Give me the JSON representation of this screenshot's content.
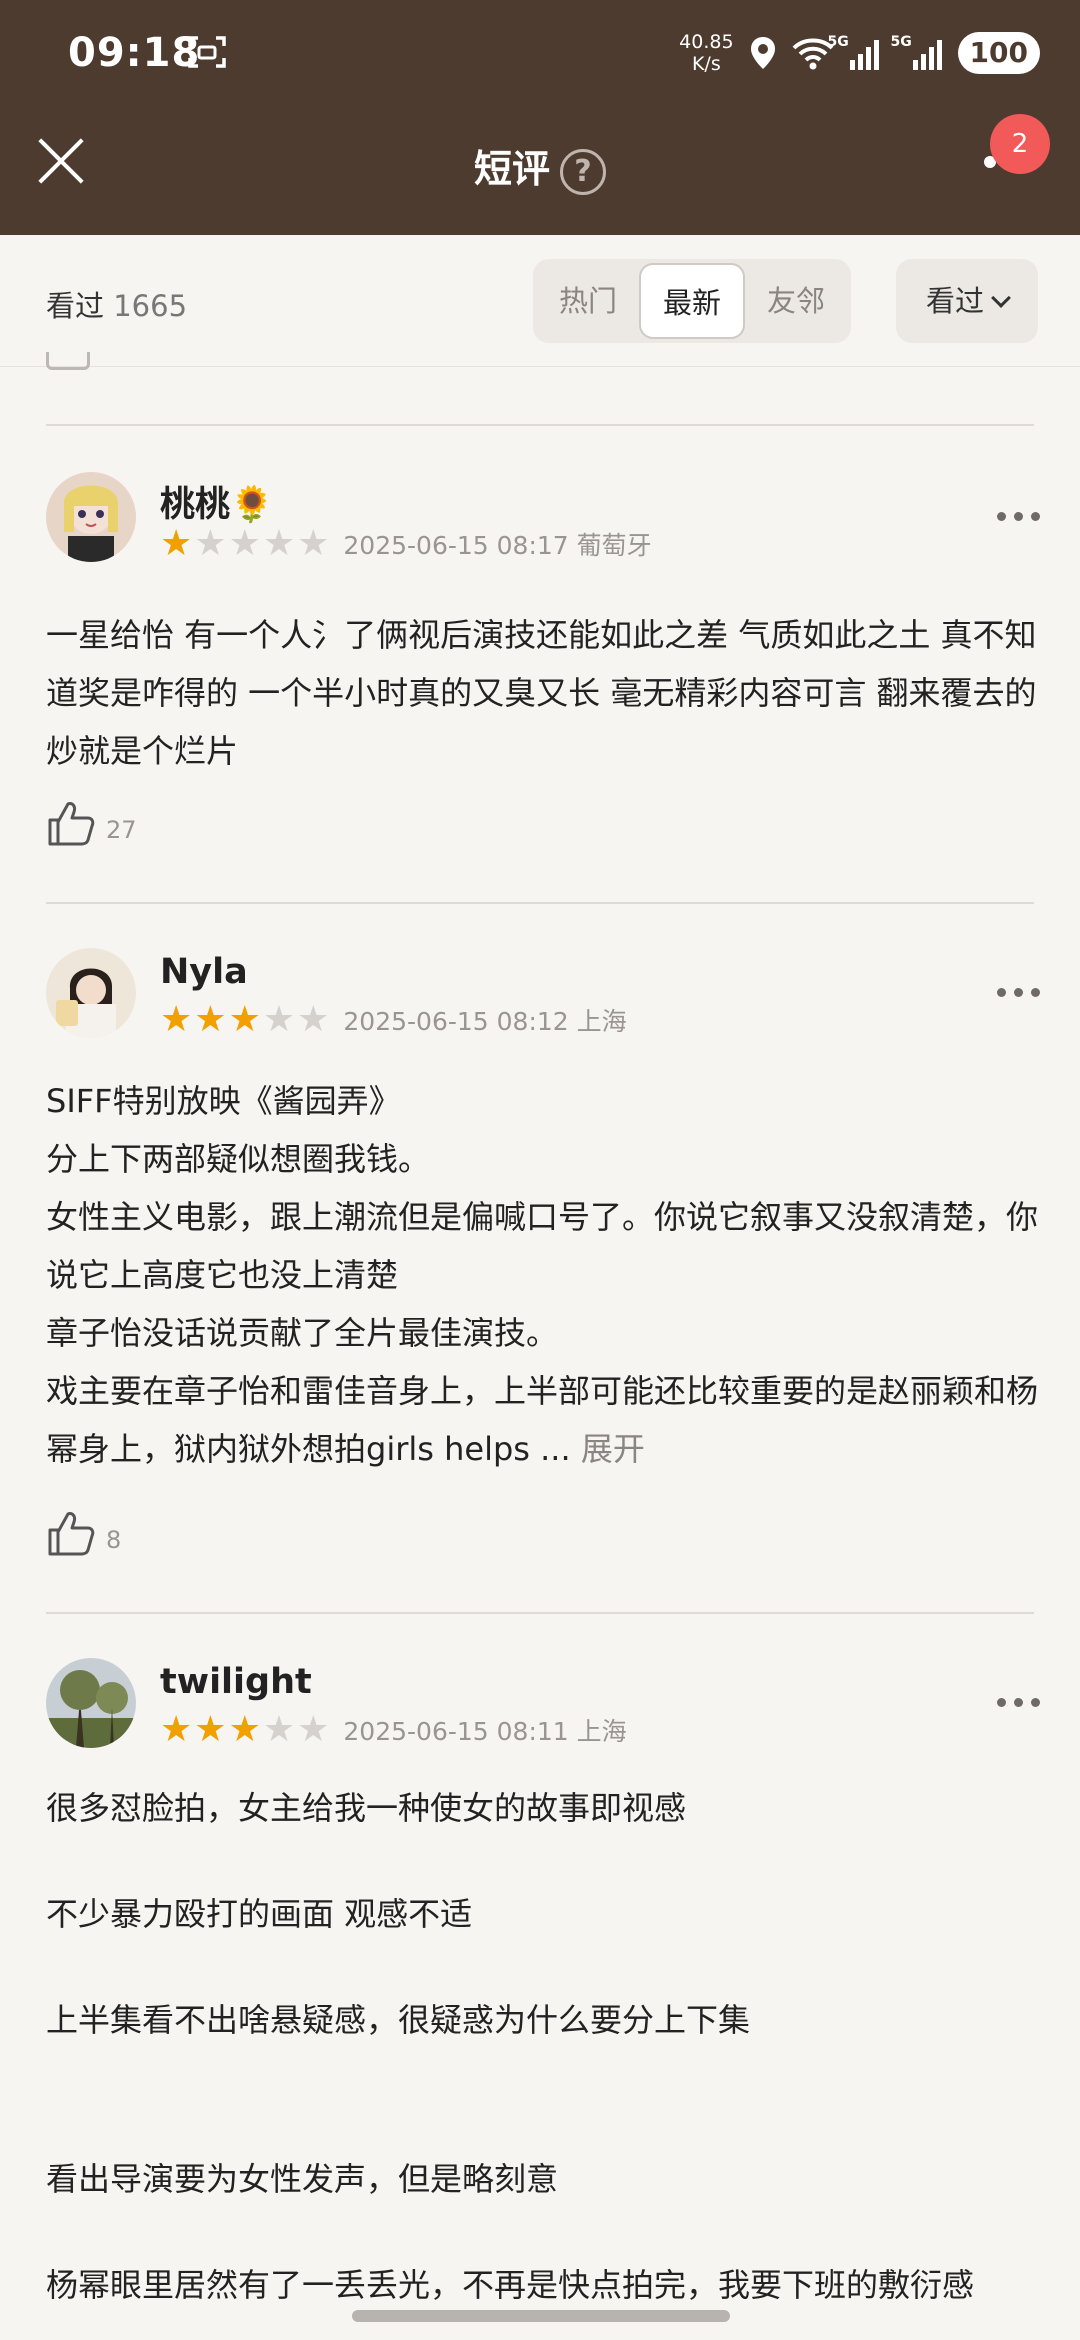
{
  "status": {
    "time": "09:18",
    "net_speed_value": "40.85",
    "net_speed_unit": "K/s",
    "sim1": "5G",
    "sim2": "5G",
    "battery": "100"
  },
  "nav": {
    "title": "短评",
    "help_glyph": "?",
    "badge_count": "2"
  },
  "filter": {
    "watched_label": "看过",
    "watched_count": "1665",
    "tabs": [
      "热门",
      "最新",
      "友邻"
    ],
    "active_tab": "最新",
    "sort_label": "看过"
  },
  "reviews": [
    {
      "user": "桃桃🌻",
      "stars": 1,
      "date": "2025-06-15 08:17",
      "location": "葡萄牙",
      "text": "一星给怡 有一个人氵了俩视后演技还能如此之差 气质如此之土 真不知道奖是咋得的 一个半小时真的又臭又长 毫无精彩内容可言 翻来覆去的炒就是个烂片",
      "likes": "27"
    },
    {
      "user": "Nyla",
      "stars": 3,
      "date": "2025-06-15 08:12",
      "location": "上海",
      "text": "SIFF特别放映《酱园弄》\n分上下两部疑似想圈我钱。\n女性主义电影，跟上潮流但是偏喊口号了。你说它叙事又没叙清楚，你说它上高度它也没上清楚\n章子怡没话说贡献了全片最佳演技。\n戏主要在章子怡和雷佳音身上，上半部可能还比较重要的是赵丽颖和杨幂身上，狱内狱外想拍girls helps ...",
      "expand_label": "展开",
      "likes": "8"
    },
    {
      "user": "twilight",
      "stars": 3,
      "date": "2025-06-15 08:11",
      "location": "上海",
      "text": "很多怼脸拍，女主给我一种使女的故事即视感\n\n不少暴力殴打的画面 观感不适\n\n上半集看不出啥悬疑感，很疑惑为什么要分上下集\n\n\n看出导演要为女性发声，但是略刻意\n\n杨幂眼里居然有了一丢丢光，不再是快点拍完，我要下班的敷衍感"
    }
  ],
  "colors": {
    "header_bg": "#4e3b2f",
    "star_on": "#f2a000",
    "badge": "#f25a5a"
  }
}
